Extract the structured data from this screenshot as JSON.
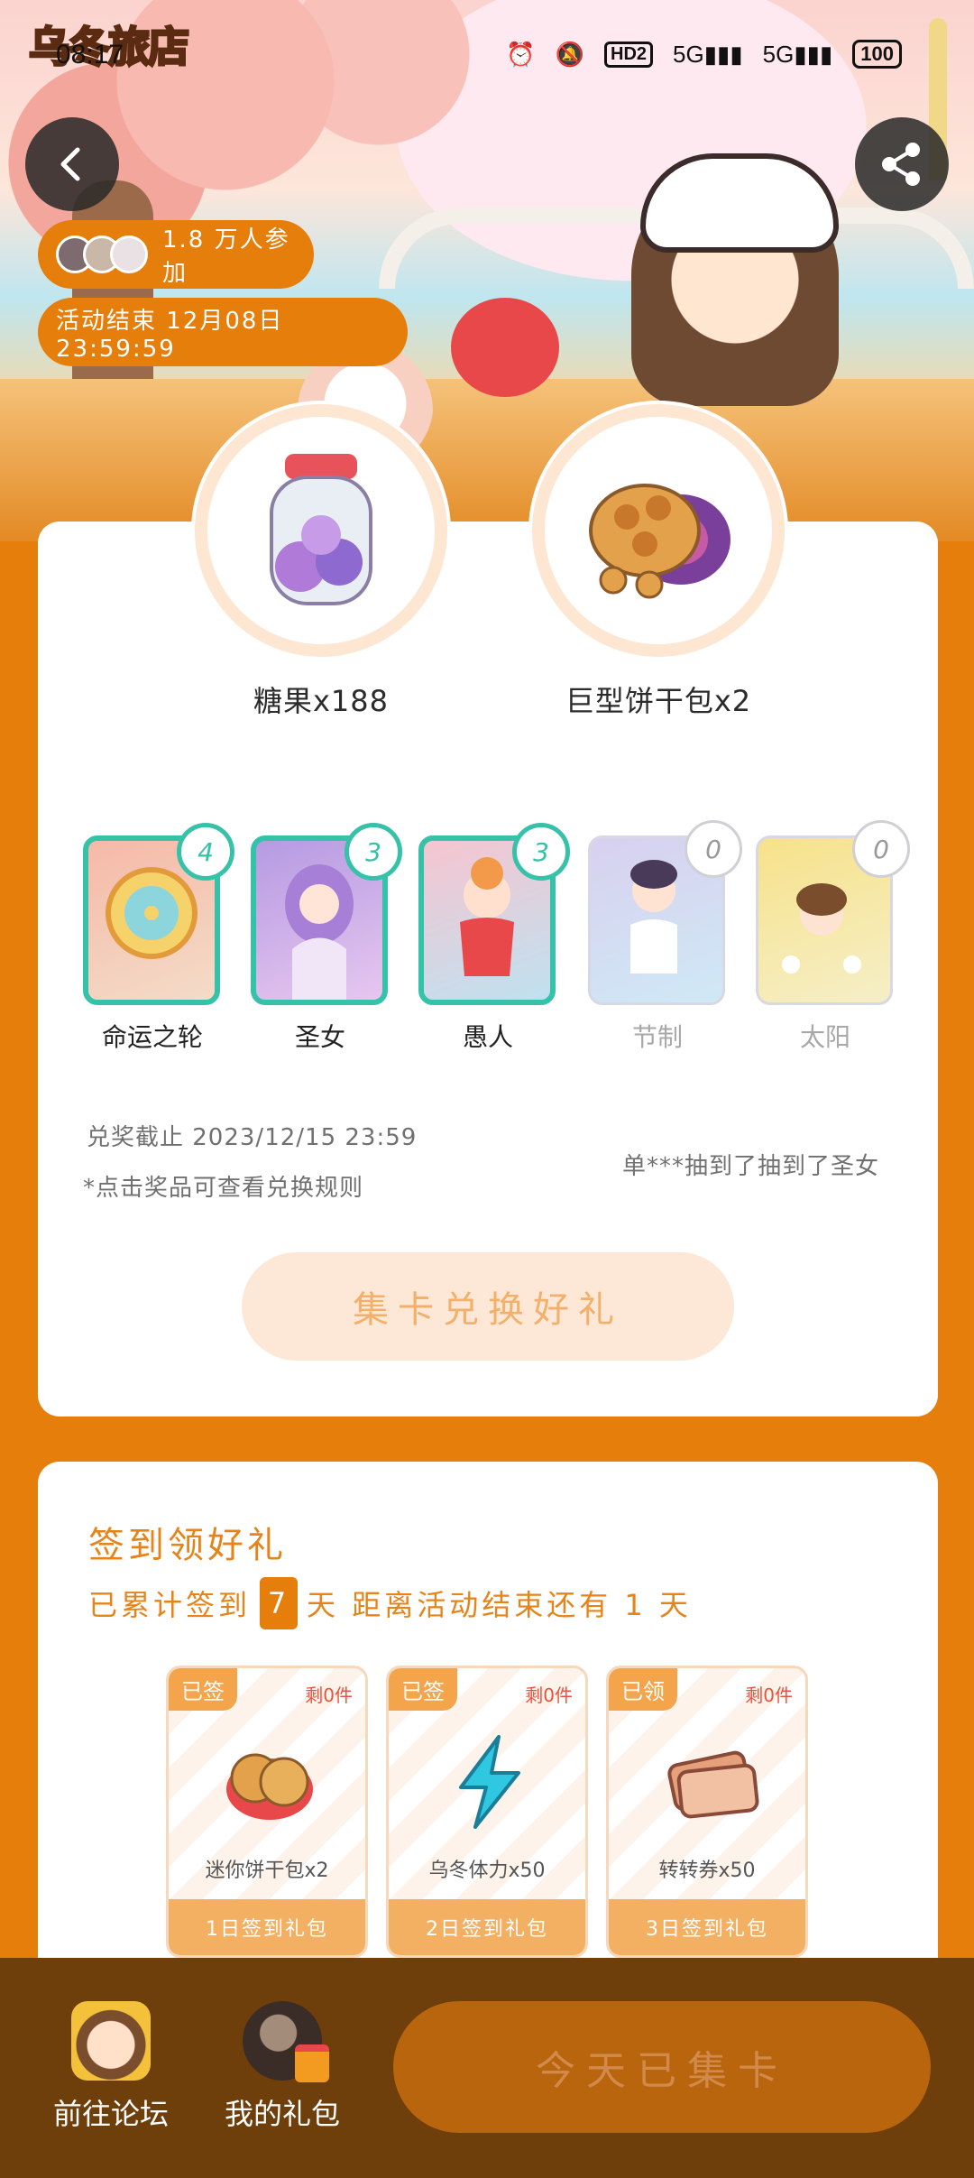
{
  "status_bar": {
    "time": "08:17",
    "icons": [
      "alarm-icon",
      "mute-icon",
      "hd-icon",
      "signal-5g-icon",
      "signal-5g-icon"
    ],
    "hd_label": "HD2",
    "net1": "5G",
    "net2": "5G",
    "battery": "100"
  },
  "app": {
    "logo_text": "乌冬旅店"
  },
  "hero": {
    "participants_text": "1.8 万人参加",
    "end_text": "活动结束 12月08日 23:59:59"
  },
  "prizes": [
    {
      "label": "糖果x188",
      "icon": "candy-jar-icon"
    },
    {
      "label": "巨型饼干包x2",
      "icon": "cookie-box-icon"
    }
  ],
  "cards": [
    {
      "name": "命运之轮",
      "count": "4",
      "owned": true
    },
    {
      "name": "圣女",
      "count": "3",
      "owned": true
    },
    {
      "name": "愚人",
      "count": "3",
      "owned": true
    },
    {
      "name": "节制",
      "count": "0",
      "owned": false
    },
    {
      "name": "太阳",
      "count": "0",
      "owned": false
    }
  ],
  "redeem": {
    "deadline": "兑奖截止 2023/12/15 23:59",
    "rule_hint": "*点击奖品可查看兑换规则",
    "ticker": "单***抽到了抽到了圣女",
    "button": "集卡兑换好礼"
  },
  "checkin": {
    "title": "签到领好礼",
    "prefix": "已累计签到",
    "days": "7",
    "suffix": "天  距离活动结束还有 1 天",
    "gifts": [
      {
        "tag": "已签",
        "remain": "剩0件",
        "item": "迷你饼干包x2",
        "footer": "1日签到礼包",
        "icon": "cookie-icon"
      },
      {
        "tag": "已签",
        "remain": "剩0件",
        "item": "乌冬体力x50",
        "footer": "2日签到礼包",
        "icon": "lightning-icon"
      },
      {
        "tag": "已领",
        "remain": "剩0件",
        "item": "转转券x50",
        "footer": "3日签到礼包",
        "icon": "ticket-icon"
      }
    ]
  },
  "bottom_nav": {
    "forum": "前往论坛",
    "my_gifts": "我的礼包",
    "collect_button": "今天已集卡"
  },
  "colors": {
    "accent": "#e67e0b",
    "teal": "#35c2a8",
    "bottom_bar": "#6f3f0b"
  }
}
